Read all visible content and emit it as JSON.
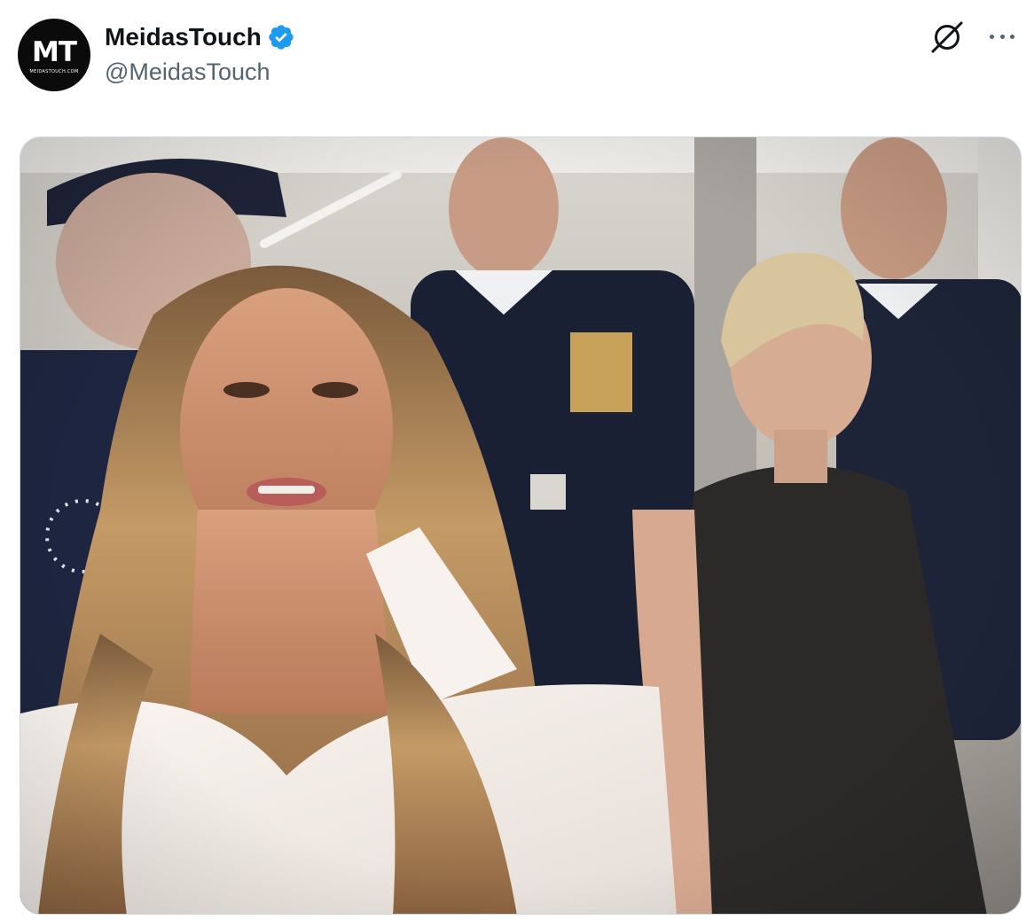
{
  "author": {
    "avatar_text": "MT",
    "avatar_subtext": "MEIDASTOUCH.COM",
    "display_name": "MeidasTouch",
    "handle": "@MeidasTouch",
    "verified": true
  },
  "icons": {
    "verified": "verified-badge-icon",
    "grok": "grok-icon",
    "more": "more-options-icon"
  },
  "media": {
    "kind": "video-still",
    "scene": "video frame"
  },
  "colors": {
    "verified_blue": "#1d9bf0",
    "handle_gray": "#536471",
    "text": "#0f1419",
    "border": "#cfd9de"
  }
}
